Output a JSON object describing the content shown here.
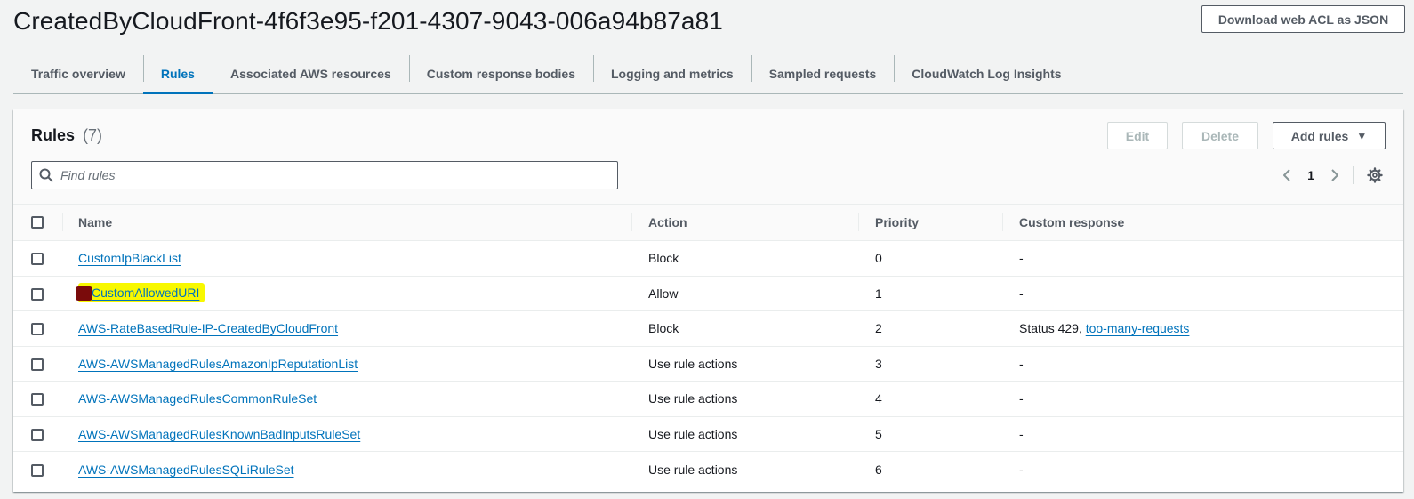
{
  "page": {
    "title": "CreatedByCloudFront-4f6f3e95-f201-4307-9043-006a94b87a81",
    "download_button": "Download web ACL as JSON"
  },
  "tabs": [
    {
      "label": "Traffic overview",
      "active": false
    },
    {
      "label": "Rules",
      "active": true
    },
    {
      "label": "Associated AWS resources",
      "active": false
    },
    {
      "label": "Custom response bodies",
      "active": false
    },
    {
      "label": "Logging and metrics",
      "active": false
    },
    {
      "label": "Sampled requests",
      "active": false
    },
    {
      "label": "CloudWatch Log Insights",
      "active": false
    }
  ],
  "rules_panel": {
    "title": "Rules",
    "count": "(7)",
    "edit_label": "Edit",
    "delete_label": "Delete",
    "add_label": "Add rules",
    "search_placeholder": "Find rules",
    "page_number": "1"
  },
  "table": {
    "headers": {
      "name": "Name",
      "action": "Action",
      "priority": "Priority",
      "custom_response": "Custom response"
    },
    "rows": [
      {
        "name": "CustomIpBlackList",
        "action": "Block",
        "priority": "0",
        "response_text": "-",
        "response_link": ""
      },
      {
        "name": "CustomAllowedURI",
        "action": "Allow",
        "priority": "1",
        "response_text": "-",
        "response_link": ""
      },
      {
        "name": "AWS-RateBasedRule-IP-CreatedByCloudFront",
        "action": "Block",
        "priority": "2",
        "response_text": "Status 429, ",
        "response_link": "too-many-requests"
      },
      {
        "name": "AWS-AWSManagedRulesAmazonIpReputationList",
        "action": "Use rule actions",
        "priority": "3",
        "response_text": "-",
        "response_link": ""
      },
      {
        "name": "AWS-AWSManagedRulesCommonRuleSet",
        "action": "Use rule actions",
        "priority": "4",
        "response_text": "-",
        "response_link": ""
      },
      {
        "name": "AWS-AWSManagedRulesKnownBadInputsRuleSet",
        "action": "Use rule actions",
        "priority": "5",
        "response_text": "-",
        "response_link": ""
      },
      {
        "name": "AWS-AWSManagedRulesSQLiRuleSet",
        "action": "Use rule actions",
        "priority": "6",
        "response_text": "-",
        "response_link": ""
      }
    ]
  },
  "icons": {
    "search": "search-icon",
    "prev": "chevron-left-icon",
    "next": "chevron-right-icon",
    "settings": "gear-icon",
    "caret": "caret-down-icon"
  },
  "colors": {
    "link": "#0073bb",
    "highlight": "#f8f800",
    "redaction": "#7a0b0b",
    "active_tab": "#0073bb"
  }
}
